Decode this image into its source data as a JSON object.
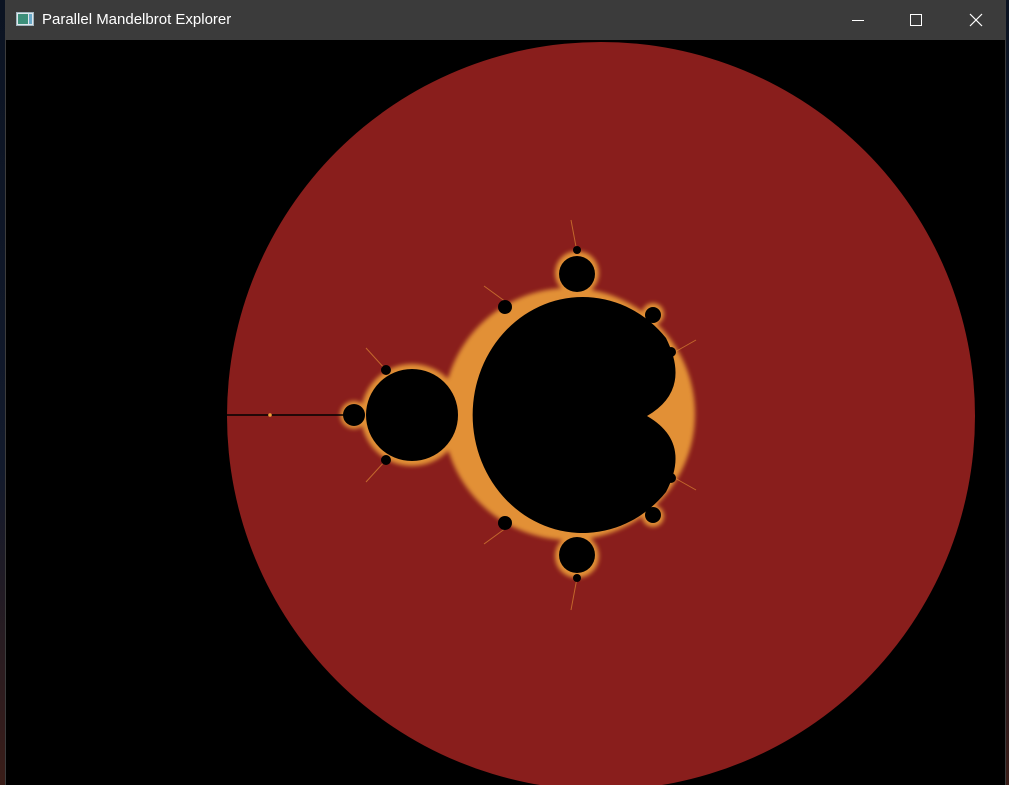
{
  "window": {
    "title": "Parallel Mandelbrot Explorer",
    "controls": {
      "minimize": "minimize-icon",
      "maximize": "maximize-icon",
      "close": "close-icon"
    }
  },
  "render": {
    "colors": {
      "background": "#000000",
      "escape_disk": "#891e1c",
      "set_interior": "#000000",
      "boundary_glow": "#f2a43a",
      "titlebar": "#3b3b3b",
      "title_text": "#ffffff"
    }
  }
}
